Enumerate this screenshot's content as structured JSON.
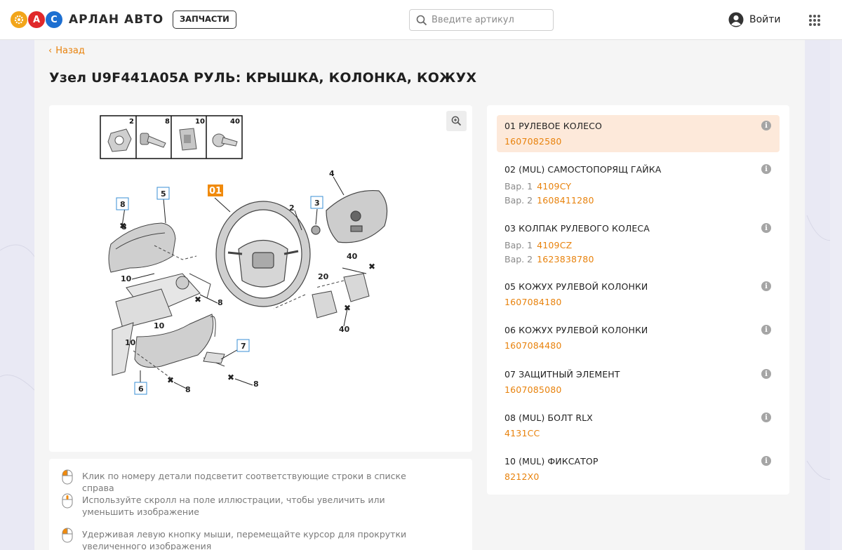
{
  "header": {
    "brand_name": "АРЛАН АВТО",
    "logo_letters": [
      "",
      "А",
      "С"
    ],
    "parts_button": "ЗАПЧАСТИ",
    "search_placeholder": "Введите артикул",
    "login_label": "Войти"
  },
  "nav": {
    "back_label": "Назад"
  },
  "page": {
    "title": "Узел U9F441A05A РУЛЬ: КРЫШКА, КОЛОНКА, КОЖУХ"
  },
  "diagram": {
    "thumb_labels": [
      "2",
      "8",
      "10",
      "40"
    ],
    "callouts": [
      "01",
      "2",
      "3",
      "4",
      "5",
      "6",
      "7",
      "8",
      "8",
      "8",
      "8",
      "8",
      "10",
      "10",
      "10",
      "20",
      "40",
      "40"
    ]
  },
  "tips": [
    "Клик по номеру детали подсветит соответствующие строки в списке справа",
    "Используйте скролл на поле иллюстрации, чтобы увеличить или уменьшить изображение",
    "Удерживая левую кнопку мыши, перемещайте курсор для прокрутки увеличенного изображения"
  ],
  "parts": [
    {
      "name": "01 РУЛЕВОЕ КОЛЕСО",
      "number": "1607082580",
      "active": true
    },
    {
      "name": "02 (MUL) САМОСТОПОРЯЩ ГАЙКА",
      "variants": [
        {
          "label": "Вар. 1",
          "number": "4109CY"
        },
        {
          "label": "Вар. 2",
          "number": "1608411280"
        }
      ]
    },
    {
      "name": "03 КОЛПАК РУЛЕВОГО КОЛЕСА",
      "variants": [
        {
          "label": "Вар. 1",
          "number": "4109CZ"
        },
        {
          "label": "Вар. 2",
          "number": "1623838780"
        }
      ]
    },
    {
      "name": "05 КОЖУХ РУЛЕВОЙ КОЛОНКИ",
      "number": "1607084180"
    },
    {
      "name": "06 КОЖУХ РУЛЕВОЙ КОЛОНКИ",
      "number": "1607084480"
    },
    {
      "name": "07 ЗАЩИТНЫЙ ЭЛЕМЕНТ",
      "number": "1607085080"
    },
    {
      "name": "08 (MUL) БОЛТ RLX",
      "number": "4131CC"
    },
    {
      "name": "10 (MUL) ФИКСАТОР",
      "number": "8212X0"
    }
  ],
  "colors": {
    "accent": "#e8820c",
    "active_row": "#fde9da",
    "info_icon": "#a5a5a5"
  }
}
